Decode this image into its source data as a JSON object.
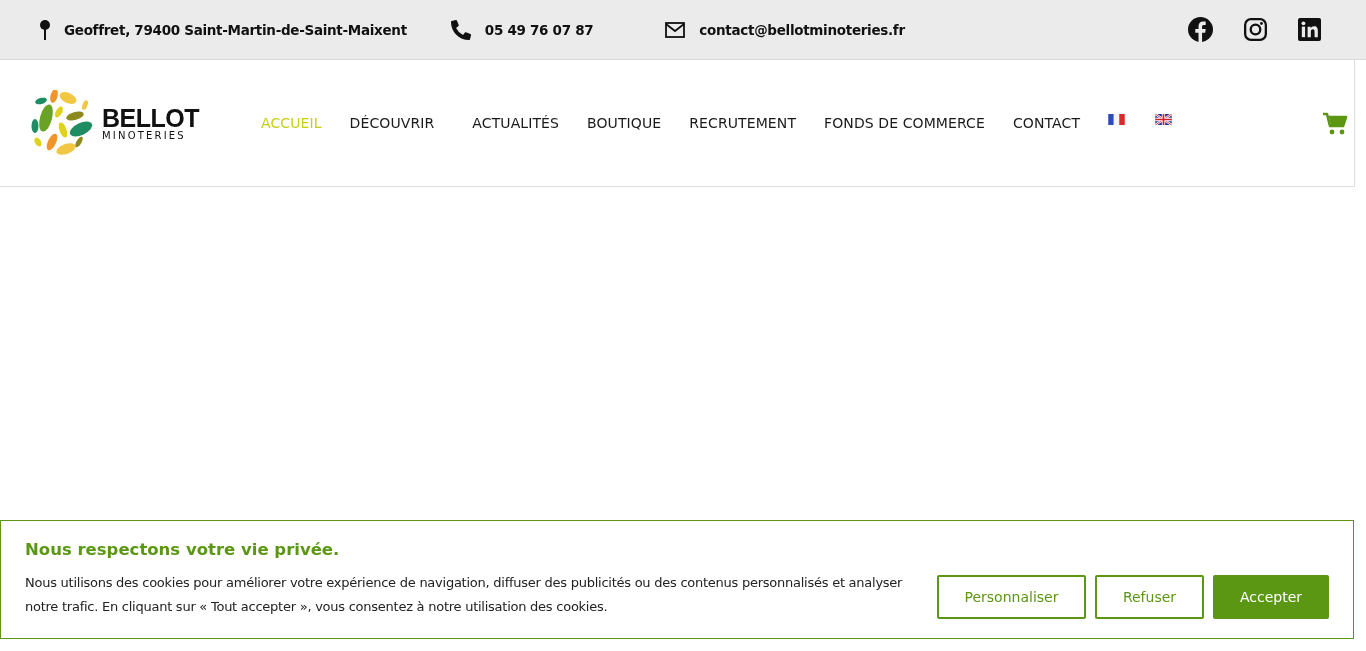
{
  "topbar": {
    "address": "Geoffret, 79400 Saint-Martin-de-Saint-Maixent",
    "phone": "05 49 76 07 87",
    "email": "contact@bellotminoteries.fr",
    "social": [
      {
        "kind": "facebook"
      },
      {
        "kind": "instagram"
      },
      {
        "kind": "linkedin"
      }
    ]
  },
  "logo": {
    "name": "BELLOT",
    "subtitle": "MINOTERIES"
  },
  "nav": [
    {
      "label": "ACCUEIL",
      "selected": true
    },
    {
      "label": "DÉCOUVRIR",
      "selected": false
    },
    {
      "label": "ACTUALITÉS",
      "selected": false
    },
    {
      "label": "BOUTIQUE",
      "selected": false
    },
    {
      "label": "RECRUTEMENT",
      "selected": false
    },
    {
      "label": "FONDS DE COMMERCE",
      "selected": false
    },
    {
      "label": "CONTACT",
      "selected": false
    }
  ],
  "languages": [
    {
      "kind": "fr"
    },
    {
      "kind": "en"
    }
  ],
  "cookie_banner": {
    "title": "Nous respectons votre vie privée.",
    "text": "Nous utilisons des cookies pour améliorer votre expérience de navigation, diffuser des publicités ou des contenus personnalisés et analyser notre trafic. En cliquant sur « Tout accepter », vous consentez à notre utilisation des cookies.",
    "buttons": [
      {
        "label": "Personnaliser",
        "kind": "outline"
      },
      {
        "label": "Refuser",
        "kind": "outline"
      },
      {
        "label": "Accepter",
        "kind": "primary"
      }
    ]
  }
}
